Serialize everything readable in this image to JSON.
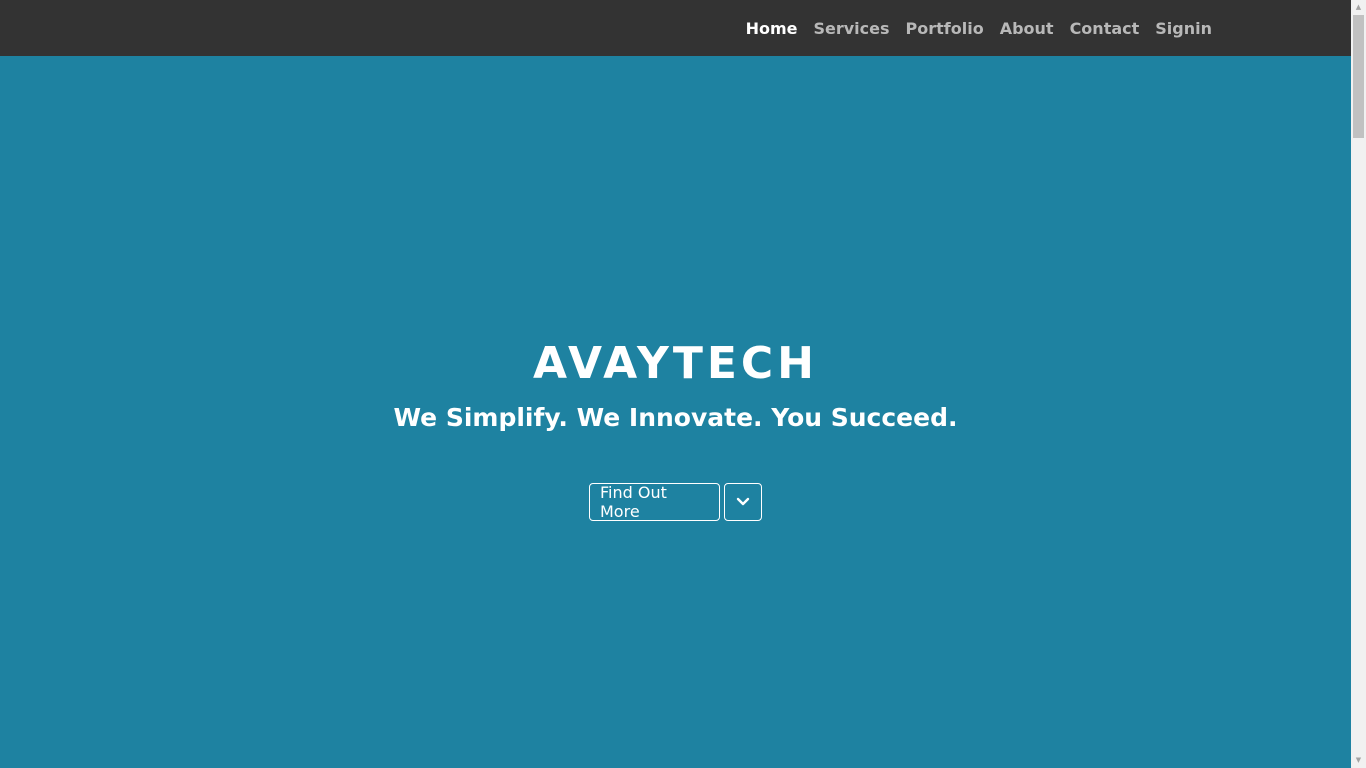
{
  "nav": {
    "items": [
      {
        "label": "Home",
        "active": true
      },
      {
        "label": "Services",
        "active": false
      },
      {
        "label": "Portfolio",
        "active": false
      },
      {
        "label": "About",
        "active": false
      },
      {
        "label": "Contact",
        "active": false
      },
      {
        "label": "Signin",
        "active": false
      }
    ]
  },
  "hero": {
    "brand": "AVAYTECH",
    "tagline": "We Simplify. We Innovate. You Succeed.",
    "cta_label": "Find Out More",
    "scroll_icon": "chevron-down-icon"
  },
  "colors": {
    "navbar_bg": "#333333",
    "hero_bg": "#1e82a1",
    "nav_active": "#ffffff",
    "nav_inactive": "#b8b8b8"
  }
}
